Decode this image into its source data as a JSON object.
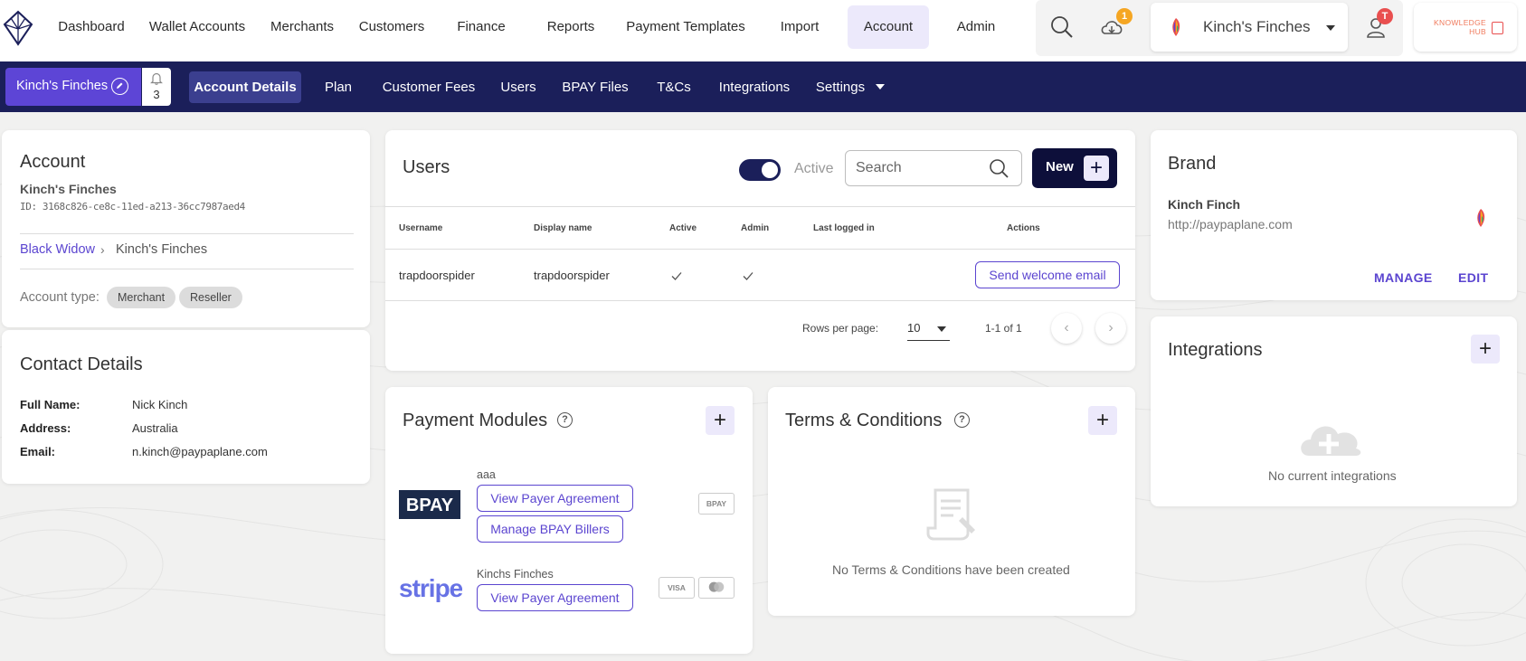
{
  "topnav": {
    "items": [
      {
        "label": "Dashboard"
      },
      {
        "label": "Wallet Accounts"
      },
      {
        "label": "Merchants"
      },
      {
        "label": "Customers"
      },
      {
        "label": "Finance"
      },
      {
        "label": "Reports"
      },
      {
        "label": "Payment Templates"
      },
      {
        "label": "Import"
      },
      {
        "label": "Account",
        "active": true
      },
      {
        "label": "Admin"
      }
    ],
    "download_badge": "1",
    "merchant_select": "Kinch's Finches",
    "user_badge": "T",
    "knowledge_hub_line1": "KNOWLEDGE",
    "knowledge_hub_line2": "HUB",
    "colors": {
      "accent": "#5d45d6",
      "badge_orange": "#f5a623",
      "badge_red": "#e94f4f"
    }
  },
  "subnav": {
    "merchant_chip": "Kinch's Finches",
    "notifications_count": "3",
    "tabs": [
      {
        "label": "Account Details",
        "active": true
      },
      {
        "label": "Plan"
      },
      {
        "label": "Customer Fees"
      },
      {
        "label": "Users"
      },
      {
        "label": "BPAY Files"
      },
      {
        "label": "T&Cs"
      },
      {
        "label": "Integrations"
      },
      {
        "label": "Settings"
      }
    ],
    "background": "#1b1f5a"
  },
  "account": {
    "title": "Account",
    "name": "Kinch's Finches",
    "id": "ID: 3168c826-ce8c-11ed-a213-36cc7987aed4",
    "breadcrumb_parent": "Black Widow",
    "breadcrumb_separator": "›",
    "breadcrumb_current": "Kinch's Finches",
    "type_label": "Account type:",
    "types": [
      "Merchant",
      "Reseller"
    ]
  },
  "contact": {
    "title": "Contact Details",
    "rows": [
      {
        "key": "Full Name:",
        "value": "Nick Kinch"
      },
      {
        "key": "Address:",
        "value": "Australia"
      },
      {
        "key": "Email:",
        "value": "n.kinch@paypaplane.com"
      }
    ]
  },
  "users": {
    "title": "Users",
    "active_toggle": "Active",
    "search_placeholder": "Search",
    "new_button": "New",
    "columns": [
      "Username",
      "Display name",
      "Active",
      "Admin",
      "Last logged in",
      "Actions"
    ],
    "rows": [
      {
        "username": "trapdoorspider",
        "display_name": "trapdoorspider",
        "active": true,
        "admin": true,
        "last_logged_in": "",
        "action": "Send welcome email"
      }
    ],
    "rows_per_page_label": "Rows per page:",
    "rows_per_page": "10",
    "range": "1-1 of 1"
  },
  "payment_modules": {
    "title": "Payment Modules",
    "modules": [
      {
        "provider": "BPAY",
        "account_name": "aaa",
        "buttons": [
          "View Payer Agreement",
          "Manage BPAY Billers"
        ],
        "card_logos": [
          "BPAY"
        ]
      },
      {
        "provider": "stripe",
        "account_name": "Kinchs Finches",
        "buttons": [
          "View Payer Agreement"
        ],
        "card_logos": [
          "VISA",
          "mastercard"
        ]
      }
    ]
  },
  "terms": {
    "title": "Terms & Conditions",
    "empty_message": "No Terms & Conditions have been created"
  },
  "brand": {
    "title": "Brand",
    "name": "Kinch Finch",
    "url": "http://paypaplane.com",
    "manage_button": "MANAGE",
    "edit_button": "EDIT"
  },
  "integrations": {
    "title": "Integrations",
    "empty_message": "No current integrations"
  }
}
